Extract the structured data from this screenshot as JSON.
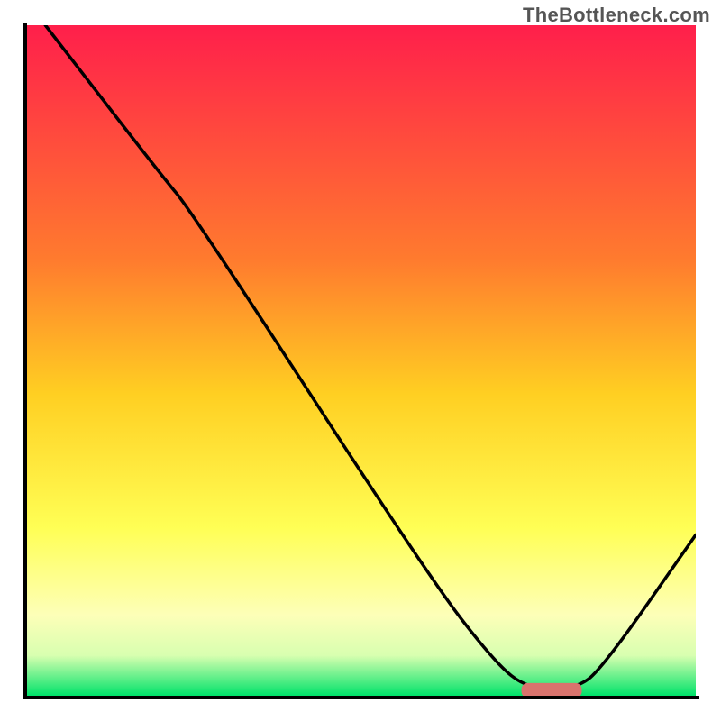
{
  "watermark": "TheBottleneck.com",
  "chart_data": {
    "type": "line",
    "title": "",
    "xlabel": "",
    "ylabel": "",
    "xlim": [
      0,
      100
    ],
    "ylim": [
      0,
      100
    ],
    "gradient_stops": [
      {
        "offset": 0,
        "color": "#ff1f4b"
      },
      {
        "offset": 35,
        "color": "#ff7b2e"
      },
      {
        "offset": 55,
        "color": "#ffcf22"
      },
      {
        "offset": 75,
        "color": "#ffff55"
      },
      {
        "offset": 88,
        "color": "#fdffb8"
      },
      {
        "offset": 94,
        "color": "#d8ffb0"
      },
      {
        "offset": 100,
        "color": "#00e26a"
      }
    ],
    "curve": [
      {
        "x": 3,
        "y": 100
      },
      {
        "x": 20,
        "y": 78
      },
      {
        "x": 25,
        "y": 72
      },
      {
        "x": 60,
        "y": 18
      },
      {
        "x": 70,
        "y": 5
      },
      {
        "x": 75,
        "y": 1
      },
      {
        "x": 82,
        "y": 1
      },
      {
        "x": 86,
        "y": 4
      },
      {
        "x": 100,
        "y": 24
      }
    ],
    "trough_marker": {
      "x_start": 74,
      "x_end": 83,
      "y": 0.8,
      "color": "#d9736d",
      "thickness": 2.2
    }
  }
}
